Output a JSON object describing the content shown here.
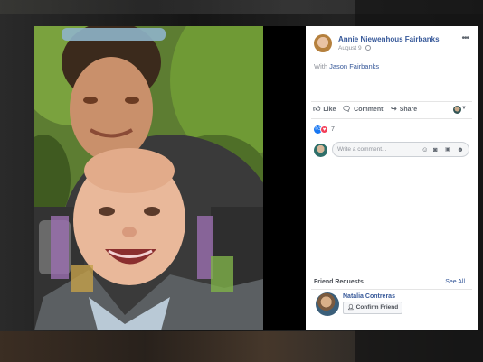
{
  "post": {
    "author": "Annie Niewenhous Fairbanks",
    "date": "August 9",
    "with_prefix": "With",
    "tagged": "Jason Fairbanks"
  },
  "actions": {
    "like": "Like",
    "comment": "Comment",
    "share": "Share"
  },
  "reactions": {
    "count": "7"
  },
  "comment": {
    "placeholder": "Write a comment..."
  },
  "friend_requests": {
    "header": "Friend Requests",
    "see_all": "See All",
    "name": "Natalia Contreras",
    "confirm": "Confirm Friend"
  },
  "icons": {
    "more": "more-icon",
    "globe": "globe-icon",
    "like": "thumbs-up-icon",
    "comment": "speech-bubble-icon",
    "share": "share-arrow-icon",
    "emoji": "emoji-icon",
    "camera": "camera-icon",
    "gif": "gif-icon",
    "sticker": "sticker-icon"
  },
  "colors": {
    "link": "#365899",
    "like": "#1877f2",
    "love": "#f33e58"
  }
}
